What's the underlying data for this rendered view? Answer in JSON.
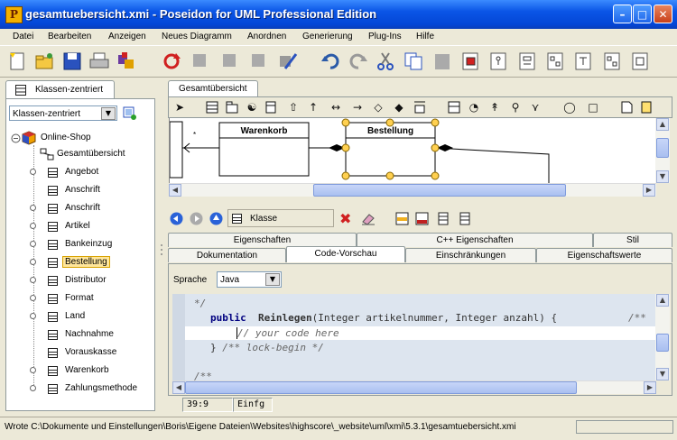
{
  "window": {
    "title": "gesamtuebersicht.xmi - Poseidon for UML Professional Edition",
    "app_icon": "poseidon-icon",
    "controls": [
      "minimize-icon",
      "maximize-icon",
      "close-icon"
    ]
  },
  "menu": [
    "Datei",
    "Bearbeiten",
    "Anzeigen",
    "Neues Diagramm",
    "Anordnen",
    "Generierung",
    "Plug-Ins",
    "Hilfe"
  ],
  "left_panel": {
    "tab_label": "Klassen-zentriert",
    "combo_value": "Klassen-zentriert",
    "tree": {
      "root": "Online-Shop",
      "diagram": "Gesamtübersicht",
      "items": [
        "Angebot",
        "Anschrift",
        "Anschrift",
        "Artikel",
        "Bankeinzug",
        "Bestellung",
        "Distributor",
        "Format",
        "Land",
        "Nachnahme",
        "Vorauskasse",
        "Warenkorb",
        "Zahlungsmethode"
      ],
      "selected": "Bestellung"
    }
  },
  "diagram": {
    "tab_label": "Gesamtübersicht",
    "classes": [
      "Warenkorb",
      "Bestellung"
    ],
    "multiplicity": "*"
  },
  "properties": {
    "element_name": "Klasse",
    "tabs_row1": [
      "Eigenschaften",
      "C++ Eigenschaften",
      "Stil"
    ],
    "tabs_row2": [
      "Dokumentation",
      "Code-Vorschau",
      "Einschränkungen",
      "Eigenschaftswerte"
    ],
    "active_tab": "Code-Vorschau",
    "language_label": "Sprache",
    "language_value": "Java",
    "code": {
      "line1": "*/",
      "line2_kw": "public",
      "line2_name": "Reinlegen",
      "line2_rest": "(Integer artikelnummer, Integer anzahl) {",
      "line2_tail": "/** ",
      "line3": "// your code here",
      "line4_brace": "} ",
      "line4_comment": "/** lock-begin */",
      "line5": "/**"
    },
    "cursor_pos": "39:9",
    "insert_mode": "Einfg"
  },
  "status": {
    "message": "Wrote C:\\Dokumente und Einstellungen\\Boris\\Eigene Dateien\\Websites\\highscore\\_website\\uml\\xmi\\5.3.1\\gesamtuebersicht.xmi"
  }
}
